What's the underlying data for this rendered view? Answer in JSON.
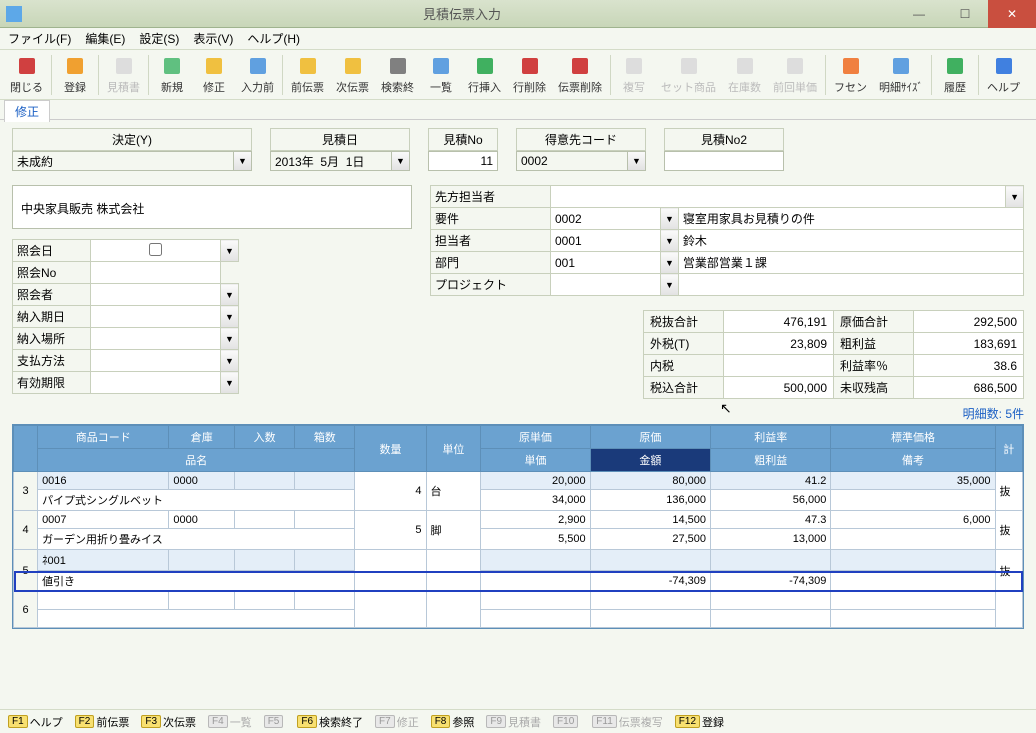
{
  "window": {
    "title": "見積伝票入力"
  },
  "menu": {
    "file": "ファイル(F)",
    "edit": "編集(E)",
    "settings": "設定(S)",
    "view": "表示(V)",
    "help": "ヘルプ(H)"
  },
  "toolbar": [
    {
      "label": "閉じる"
    },
    {
      "label": "登録"
    },
    {
      "label": "見積書",
      "disabled": true
    },
    {
      "label": "新規"
    },
    {
      "label": "修正"
    },
    {
      "label": "入力前"
    },
    {
      "label": "前伝票"
    },
    {
      "label": "次伝票"
    },
    {
      "label": "検索終"
    },
    {
      "label": "一覧"
    },
    {
      "label": "行挿入"
    },
    {
      "label": "行削除"
    },
    {
      "label": "伝票削除"
    },
    {
      "label": "複写",
      "disabled": true
    },
    {
      "label": "セット商品",
      "disabled": true
    },
    {
      "label": "在庫数",
      "disabled": true
    },
    {
      "label": "前回単価",
      "disabled": true
    },
    {
      "label": "フセン"
    },
    {
      "label": "明細ｻｲｽﾞ"
    },
    {
      "label": "履歴"
    },
    {
      "label": "ヘルプ"
    }
  ],
  "mode": "修正",
  "header": {
    "decision_label": "決定(Y)",
    "decision_value": "未成約",
    "estimate_date_label": "見積日",
    "estimate_date_value": "2013年  5月  1日",
    "estimate_no_label": "見積No",
    "estimate_no_value": "11",
    "customer_code_label": "得意先コード",
    "customer_code_value": "0002",
    "estimate_no2_label": "見積No2",
    "estimate_no2_value": ""
  },
  "company": "中央家具販売 株式会社",
  "left_fields": {
    "inquiry_date": "照会日",
    "inquiry_no": "照会No",
    "inquiry_person": "照会者",
    "delivery_date": "納入期日",
    "delivery_place": "納入場所",
    "payment": "支払方法",
    "valid_until": "有効期限"
  },
  "right_fields": {
    "contact_person": {
      "label": "先方担当者",
      "value": ""
    },
    "subject": {
      "label": "要件",
      "code": "0002",
      "text": "寝室用家具お見積りの件"
    },
    "rep": {
      "label": "担当者",
      "code": "0001",
      "text": "鈴木"
    },
    "dept": {
      "label": "部門",
      "code": "001",
      "text": "営業部営業１課"
    },
    "project": {
      "label": "プロジェクト",
      "code": "",
      "text": ""
    }
  },
  "totals": {
    "subtotal_label": "税抜合計",
    "subtotal": "476,191",
    "outer_tax_label": "外税(T)",
    "outer_tax": "23,809",
    "inner_tax_label": "内税",
    "inner_tax": "",
    "total_label": "税込合計",
    "total": "500,000",
    "cost_total_label": "原価合計",
    "cost_total": "292,500",
    "gross_profit_label": "粗利益",
    "gross_profit": "183,691",
    "profit_rate_label": "利益率％",
    "profit_rate": "38.6",
    "unpaid_label": "未収残高",
    "unpaid": "686,500"
  },
  "detail_count": "明細数: 5件",
  "grid_headers": {
    "row": "",
    "product_code": "商品コード",
    "warehouse": "倉庫",
    "box_qty": "入数",
    "box_count": "箱数",
    "qty": "数量",
    "unit": "単位",
    "unit_price": "原単価",
    "cost": "原価",
    "profit_rate": "利益率",
    "std_price": "標準価格",
    "product_name": "品名",
    "sell_price": "単価",
    "amount": "金額",
    "gross": "粗利益",
    "remark": "備考",
    "total_col": "計"
  },
  "rows": [
    {
      "n": "3",
      "code": "0016",
      "wh": "0000",
      "boxqty": "",
      "boxcnt": "",
      "qty": "4",
      "unit": "台",
      "ucost": "20,000",
      "cost": "80,000",
      "prate": "41.2",
      "stdprice": "35,000",
      "name": "パイプ式シングルベット",
      "uprice": "34,000",
      "amount": "136,000",
      "gross": "56,000",
      "remark": "",
      "tax": "抜"
    },
    {
      "n": "4",
      "code": "0007",
      "wh": "0000",
      "boxqty": "",
      "boxcnt": "",
      "qty": "5",
      "unit": "脚",
      "ucost": "2,900",
      "cost": "14,500",
      "prate": "47.3",
      "stdprice": "6,000",
      "name": "ガーデン用折り畳みイス",
      "uprice": "5,500",
      "amount": "27,500",
      "gross": "13,000",
      "remark": "",
      "tax": "抜"
    },
    {
      "n": "5",
      "code": "ﾈ001",
      "wh": "",
      "boxqty": "",
      "boxcnt": "",
      "qty": "",
      "unit": "",
      "ucost": "",
      "cost": "",
      "prate": "",
      "stdprice": "",
      "name": "値引き",
      "uprice": "",
      "amount": "-74,309",
      "gross": "-74,309",
      "remark": "",
      "tax": "抜"
    },
    {
      "n": "6",
      "code": "",
      "wh": "",
      "boxqty": "",
      "boxcnt": "",
      "qty": "",
      "unit": "",
      "ucost": "",
      "cost": "",
      "prate": "",
      "stdprice": "",
      "name": "",
      "uprice": "",
      "amount": "",
      "gross": "",
      "remark": "",
      "tax": ""
    }
  ],
  "funckeys": [
    {
      "key": "F1",
      "label": "ヘルプ",
      "on": true
    },
    {
      "key": "F2",
      "label": "前伝票",
      "on": true
    },
    {
      "key": "F3",
      "label": "次伝票",
      "on": true
    },
    {
      "key": "F4",
      "label": "一覧",
      "on": false
    },
    {
      "key": "F5",
      "label": "",
      "on": false
    },
    {
      "key": "F6",
      "label": "検索終了",
      "on": true
    },
    {
      "key": "F7",
      "label": "修正",
      "on": false
    },
    {
      "key": "F8",
      "label": "参照",
      "on": true
    },
    {
      "key": "F9",
      "label": "見積書",
      "on": false
    },
    {
      "key": "F10",
      "label": "",
      "on": false
    },
    {
      "key": "F11",
      "label": "伝票複写",
      "on": false
    },
    {
      "key": "F12",
      "label": "登録",
      "on": true
    }
  ]
}
